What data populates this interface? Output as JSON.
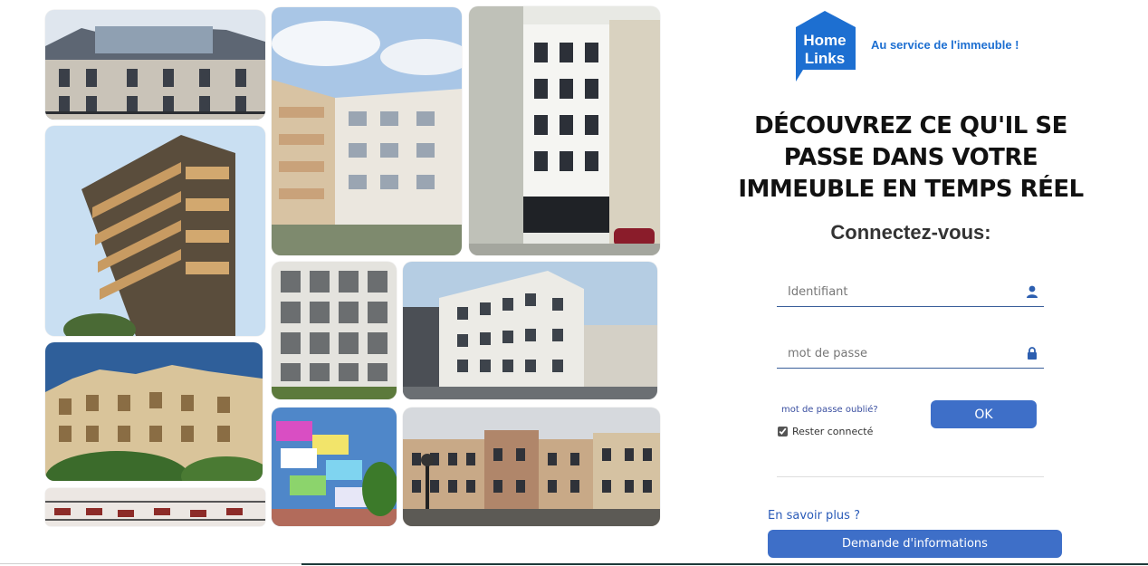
{
  "brand": {
    "logo_line1": "Home",
    "logo_line2": "Links",
    "tagline": "Au service de l'immeuble !",
    "logo_color": "#1d6fd1"
  },
  "headline": {
    "line1": "DÉCOUVREZ CE QU'IL SE",
    "line2": "PASSE DANS VOTRE",
    "line3": "IMMEUBLE EN TEMPS RÉEL"
  },
  "login": {
    "title": "Connectez-vous:",
    "username_placeholder": "Identifiant",
    "username_value": "",
    "username_icon": "user-icon",
    "password_placeholder": "mot de passe",
    "password_value": "",
    "password_icon": "lock-icon",
    "forgot_label": "mot de passe oublié?",
    "ok_label": "OK",
    "remember_label": "Rester connecté",
    "remember_checked": true
  },
  "footer": {
    "more_label": "En savoir plus ?",
    "info_button_label": "Demande d'informations"
  },
  "colors": {
    "accent": "#3e6fc8",
    "link": "#2a5bb8"
  },
  "collage": {
    "photos": [
      "paris-rooftop-photo",
      "wooden-courtyard-building-photo",
      "white-facade-building-photo",
      "wooden-tower-photo",
      "glass-balcony-building-photo",
      "corner-office-building-photo",
      "haussmann-building-photo",
      "colorful-stacked-building-photo",
      "parisian-row-buildings-photo",
      "balconies-building-photo"
    ]
  }
}
